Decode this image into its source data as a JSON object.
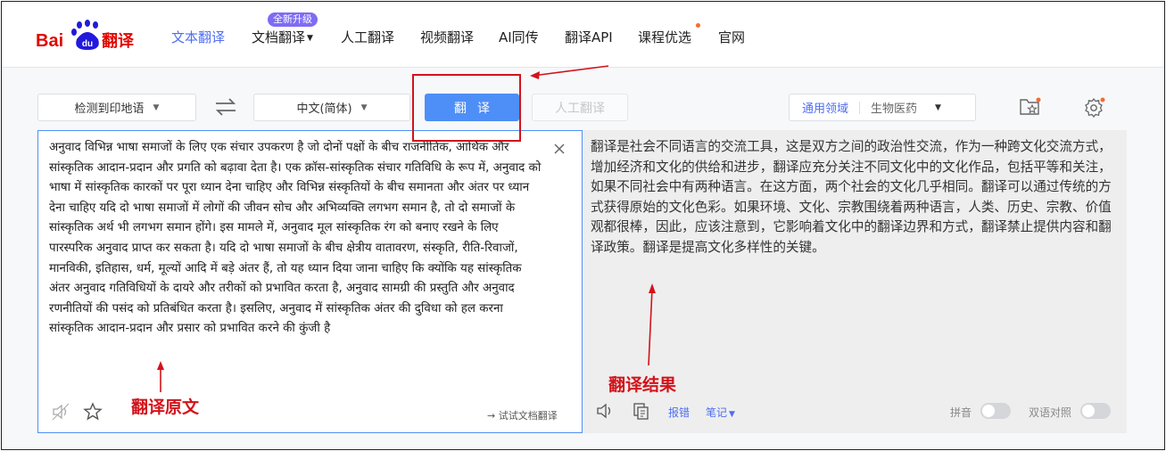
{
  "app": {
    "logo": {
      "bai": "Bai",
      "du": "du",
      "fanyi": "翻译"
    }
  },
  "nav": {
    "items": [
      {
        "label": "文本翻译",
        "active": true
      },
      {
        "label": "文档翻译"
      },
      {
        "label": "人工翻译"
      },
      {
        "label": "视频翻译"
      },
      {
        "label": "AI同传"
      },
      {
        "label": "翻译API"
      },
      {
        "label": "课程优选"
      },
      {
        "label": "官网"
      }
    ],
    "badge": "全新升级"
  },
  "toolbar": {
    "source_lang": "检测到印地语",
    "target_lang": "中文(简体)",
    "translate_label": "翻译",
    "human_label": "人工翻译",
    "domain_active": "通用领域",
    "domain_other": "生物医药"
  },
  "source": {
    "text": "अनुवाद विभिन्न भाषा समाजों के लिए एक संचार उपकरण है जो दोनों पक्षों के बीच राजनीतिक, आर्थिक और सांस्कृतिक आदान-प्रदान और प्रगति को बढ़ावा देता है। एक क्रॉस-सांस्कृतिक संचार गतिविधि के रूप में, अनुवाद को भाषा में सांस्कृतिक कारकों पर पूरा ध्यान देना चाहिए और विभिन्न संस्कृतियों के बीच समानता और अंतर पर ध्यान देना चाहिए यदि दो भाषा समाजों में लोगों की जीवन सोच और अभिव्यक्ति लगभग समान है, तो दो समाजों के सांस्कृतिक अर्थ भी लगभग समान होंगे। इस मामले में, अनुवाद मूल सांस्कृतिक रंग को बनाए रखने के लिए पारस्परिक अनुवाद प्राप्त कर सकता है। यदि दो भाषा समाजों के बीच क्षेत्रीय वातावरण, संस्कृति, रीति-रिवाजों, मानविकी, इतिहास, धर्म, मूल्यों आदि में बड़े अंतर हैं, तो यह ध्यान दिया जाना चाहिए कि क्योंकि यह सांस्कृतिक अंतर अनुवाद गतिविधियों के दायरे और तरीकों को प्रभावित करता है, अनुवाद सामग्री की प्रस्तुति और अनुवाद रणनीतियों की पसंद को प्रतिबंधित करता है। इसलिए, अनुवाद में सांस्कृतिक अंतर की दुविधा को हल करना सांस्कृतिक आदान-प्रदान और प्रसार को प्रभावित करने की कुंजी है",
    "doc_link": "→ 试试文档翻译"
  },
  "result": {
    "text": "翻译是社会不同语言的交流工具，这是双方之间的政治性交流，作为一种跨文化交流方式，增加经济和文化的供给和进步，翻译应充分关注不同文化中的文化作品，包括平等和关注，如果不同社会中有两种语言。在这方面，两个社会的文化几乎相同。翻译可以通过传统的方式获得原始的文化色彩。如果环境、文化、宗教围绕着两种语言，人类、历史、宗教、价值观都很棒，因此，应该注意到，它影响着文化中的翻译边界和方式，翻译禁止提供内容和翻译政策。翻译是提高文化多样性的关键。",
    "report": "报错",
    "notes": "笔记",
    "pinyin": "拼音",
    "bilingual": "双语对照"
  },
  "annotations": {
    "source_label": "翻译原文",
    "result_label": "翻译结果"
  },
  "colors": {
    "brand_blue": "#4e6ef2",
    "button_blue": "#4e8ef7",
    "annotation_red": "#d3131a",
    "logo_red": "#e10601",
    "logo_blue": "#2319dc"
  }
}
